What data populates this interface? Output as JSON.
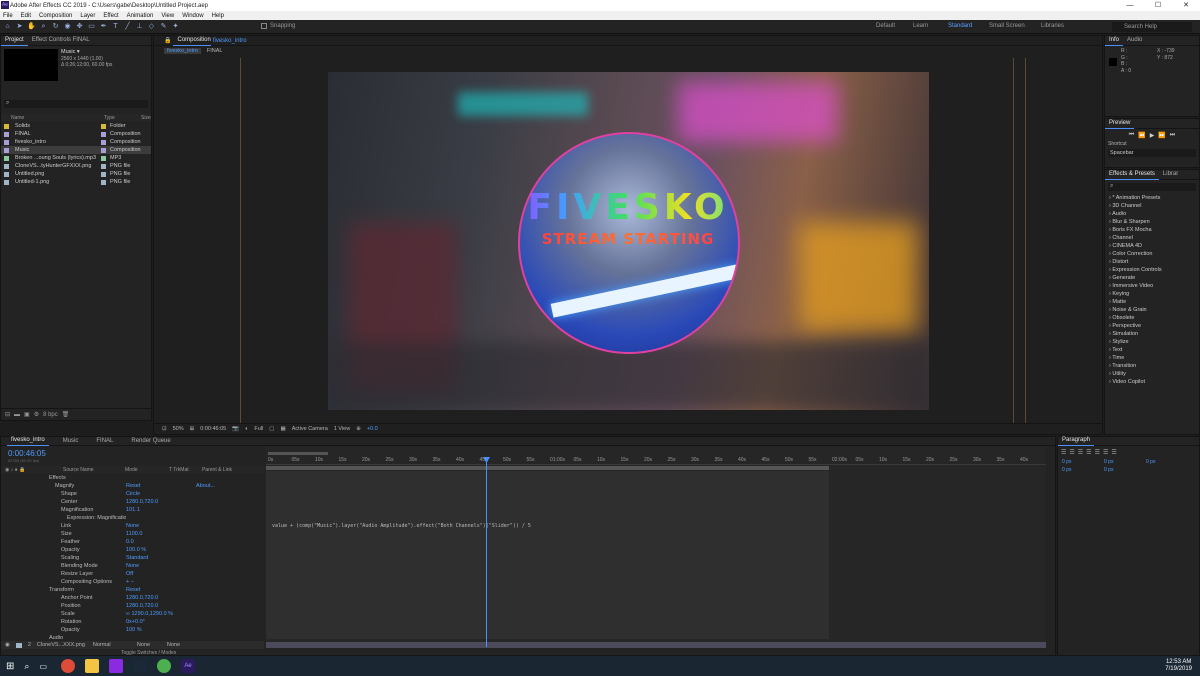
{
  "window": {
    "title": "Adobe After Effects CC 2019 - C:\\Users\\gabe\\Desktop\\Untitled Project.aep",
    "min": "—",
    "max": "☐",
    "close": "✕"
  },
  "menu": [
    "File",
    "Edit",
    "Composition",
    "Layer",
    "Effect",
    "Animation",
    "View",
    "Window",
    "Help"
  ],
  "toolbar": {
    "snapping": "Snapping",
    "workspaces": [
      "Default",
      "Learn",
      "Standard",
      "Small Screen",
      "Libraries"
    ],
    "search": "Search Help"
  },
  "project": {
    "tab1": "Project",
    "tab2": "Effect Controls FINAL",
    "item": "Music ▾",
    "info1": "2560 x 1440 (1.00)",
    "info2": "Δ 0;26;12;00, 60.00 fps",
    "col_name": "Name",
    "col_type": "Type",
    "col_size": "Size",
    "rows": [
      {
        "name": "Solids",
        "type": "Folder",
        "color": "#d6b93a"
      },
      {
        "name": "FINAL",
        "type": "Composition",
        "color": "#a89fd6"
      },
      {
        "name": "fivesko_intro",
        "type": "Composition",
        "color": "#a89fd6"
      },
      {
        "name": "Music",
        "type": "Composition",
        "color": "#a89fd6"
      },
      {
        "name": "Broken ...oung Souls (lyrics).mp3",
        "type": "MP3",
        "color": "#8cc8a0"
      },
      {
        "name": "CloneVS...tyHunterGFXXX.png",
        "type": "PNG file",
        "color": "#a0b4c8"
      },
      {
        "name": "Untitled.png",
        "type": "PNG file",
        "color": "#a0b4c8"
      },
      {
        "name": "Untitled-1.png",
        "type": "PNG file",
        "color": "#a0b4c8"
      }
    ],
    "bpc": "8 bpc"
  },
  "comp": {
    "tab": "Composition",
    "tab_name": "fivesko_intro",
    "crumb1": "fivesko_intro",
    "crumb2": "FINAL",
    "title": "FIVESKO",
    "subtitle": "STREAM STARTING",
    "zoom": "50%",
    "time": "0:00:46:05",
    "res": "Full",
    "camera": "Active Camera",
    "view": "1 View",
    "offset": "+0.0"
  },
  "info": {
    "tab1": "Info",
    "tab2": "Audio",
    "r": "R :",
    "g": "G :",
    "b": "B :",
    "a": "A : 0",
    "x": "X : -739",
    "y": "Y : 872"
  },
  "preview": {
    "tab": "Preview",
    "shortcut_label": "Shortcut",
    "shortcut": "Spacebar"
  },
  "effects": {
    "tab1": "Effects & Presets",
    "tab2": "Librar",
    "items": [
      "* Animation Presets",
      "3D Channel",
      "Audio",
      "Blur & Sharpen",
      "Boris FX Mocha",
      "Channel",
      "CINEMA 4D",
      "Color Correction",
      "Distort",
      "Expression Controls",
      "Generate",
      "Immersive Video",
      "Keying",
      "Matte",
      "Noise & Grain",
      "Obsolete",
      "Perspective",
      "Simulation",
      "Stylize",
      "Text",
      "Time",
      "Transition",
      "Utility",
      "Video Copilot"
    ]
  },
  "timeline": {
    "tabs": [
      "fivesko_intro",
      "Music",
      "FINAL",
      "Render Queue"
    ],
    "time": "0:00:46:05",
    "frames": "02765 (60.00 fps)",
    "col_source": "Source Name",
    "col_mode": "Mode",
    "col_trkmat": "T TrkMat",
    "col_parent": "Parent & Link",
    "ticks": [
      "0s",
      "05s",
      "10s",
      "15s",
      "20s",
      "25s",
      "30s",
      "35s",
      "40s",
      "45s",
      "50s",
      "55s",
      "01:00s",
      "05s",
      "10s",
      "15s",
      "20s",
      "25s",
      "30s",
      "35s",
      "40s",
      "45s",
      "50s",
      "55s",
      "02:00s",
      "05s",
      "10s",
      "15s",
      "20s",
      "25s",
      "30s",
      "35s",
      "40s"
    ],
    "rows": [
      {
        "l": "Effects",
        "v": "",
        "ind": 1
      },
      {
        "l": "Magnify",
        "v": "Reset",
        "v2": "About...",
        "ind": 2
      },
      {
        "l": "Shape",
        "v": "Circle",
        "ind": 3
      },
      {
        "l": "Center",
        "v": "1280.0,720.0",
        "ind": 3
      },
      {
        "l": "Magnification",
        "v": "101.1",
        "ind": 3,
        "red": true
      },
      {
        "l": "Expression: Magnification",
        "v": "",
        "ind": 4
      },
      {
        "l": "Link",
        "v": "None",
        "ind": 3
      },
      {
        "l": "Size",
        "v": "1100.0",
        "ind": 3
      },
      {
        "l": "Feather",
        "v": "0.0",
        "ind": 3
      },
      {
        "l": "Opacity",
        "v": "100.0 %",
        "ind": 3
      },
      {
        "l": "Scaling",
        "v": "Standard",
        "ind": 3
      },
      {
        "l": "Blending Mode",
        "v": "None",
        "ind": 3
      },
      {
        "l": "Resize Layer",
        "v": "Off",
        "ind": 3
      },
      {
        "l": "Compositing Options",
        "v": "+ −",
        "ind": 3
      },
      {
        "l": "Transform",
        "v": "Reset",
        "ind": 1
      },
      {
        "l": "Anchor Point",
        "v": "1280.0,720.0",
        "ind": 3
      },
      {
        "l": "Position",
        "v": "1280.0,720.0",
        "ind": 3
      },
      {
        "l": "Scale",
        "v": "∞ 1290.0,1290.0 %",
        "ind": 3
      },
      {
        "l": "Rotation",
        "v": "0x+0.0°",
        "ind": 3
      },
      {
        "l": "Opacity",
        "v": "100 %",
        "ind": 3
      },
      {
        "l": "Audio",
        "v": "",
        "ind": 1
      }
    ],
    "layer2": {
      "num": "2",
      "name": "CloneVS...XXX.png",
      "mode": "Normal",
      "trk": "None",
      "parent": "None"
    },
    "expression": "value + (comp(\"Music\").layer(\"Audio Amplitude\").effect(\"Both Channels\")(\"Slider\")) / 5",
    "toggle": "Toggle Switches / Modes"
  },
  "paragraph": {
    "tab": "Paragraph",
    "px": [
      "0 px",
      "0 px",
      "0 px",
      "0 px",
      "0 px"
    ]
  },
  "taskbar": {
    "time": "12:53 AM",
    "date": "7/19/2019"
  }
}
